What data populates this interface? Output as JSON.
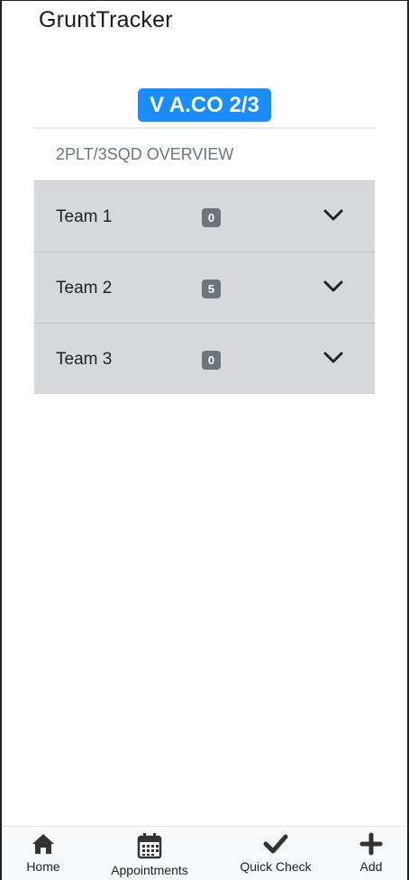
{
  "app": {
    "title": "GruntTracker"
  },
  "unit": {
    "badge": "V A.CO 2/3"
  },
  "overview": {
    "title": "2PLT/3SQD OVERVIEW",
    "teams": [
      {
        "label": "Team 1",
        "count": "0"
      },
      {
        "label": "Team 2",
        "count": "5"
      },
      {
        "label": "Team 3",
        "count": "0"
      }
    ]
  },
  "tabbar": {
    "items": [
      {
        "label": "Home",
        "icon": "home-icon"
      },
      {
        "label": "Appointments",
        "icon": "calendar-icon"
      },
      {
        "label": "Quick Check",
        "icon": "check-icon"
      },
      {
        "label": "Add",
        "icon": "plus-icon"
      }
    ]
  },
  "colors": {
    "accent": "#1a8cff",
    "badge": "#6c757d",
    "row": "#d6d8db"
  }
}
